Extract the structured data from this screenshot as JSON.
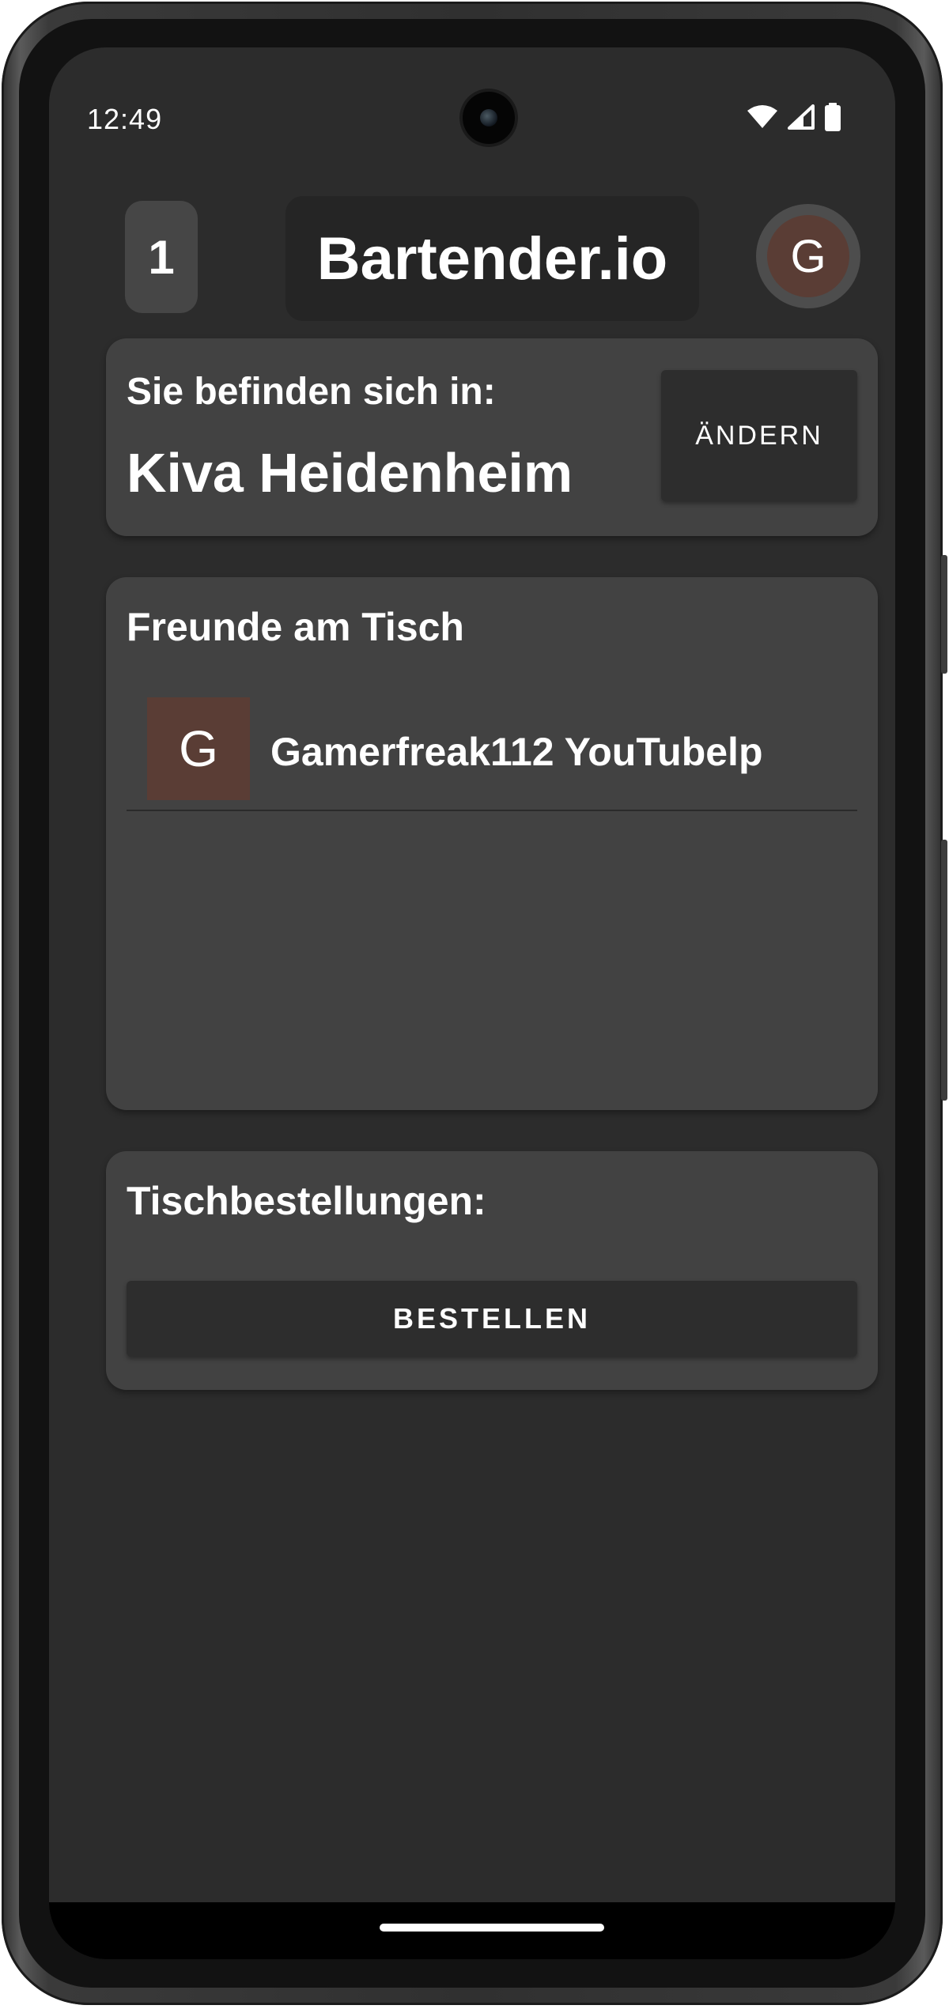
{
  "status_bar": {
    "time": "12:49",
    "icons": [
      "wifi-icon",
      "cellular-signal-icon",
      "battery-icon"
    ]
  },
  "header": {
    "count_badge": "1",
    "app_title": "Bartender.io",
    "avatar_initial": "G"
  },
  "location_card": {
    "label": "Sie befinden sich in:",
    "location_name": "Kiva Heidenheim",
    "change_button": "ÄNDERN"
  },
  "friends_card": {
    "title": "Freunde am Tisch",
    "friends": [
      {
        "initial": "G",
        "name": "Gamerfreak112 YouTubelp"
      }
    ]
  },
  "orders_card": {
    "title": "Tischbestellungen:",
    "order_button": "BESTELLEN"
  },
  "colors": {
    "background": "#2c2c2c",
    "card": "#424242",
    "button": "#2d2d2d",
    "avatar": "#5a3d35",
    "text": "#ffffff"
  }
}
